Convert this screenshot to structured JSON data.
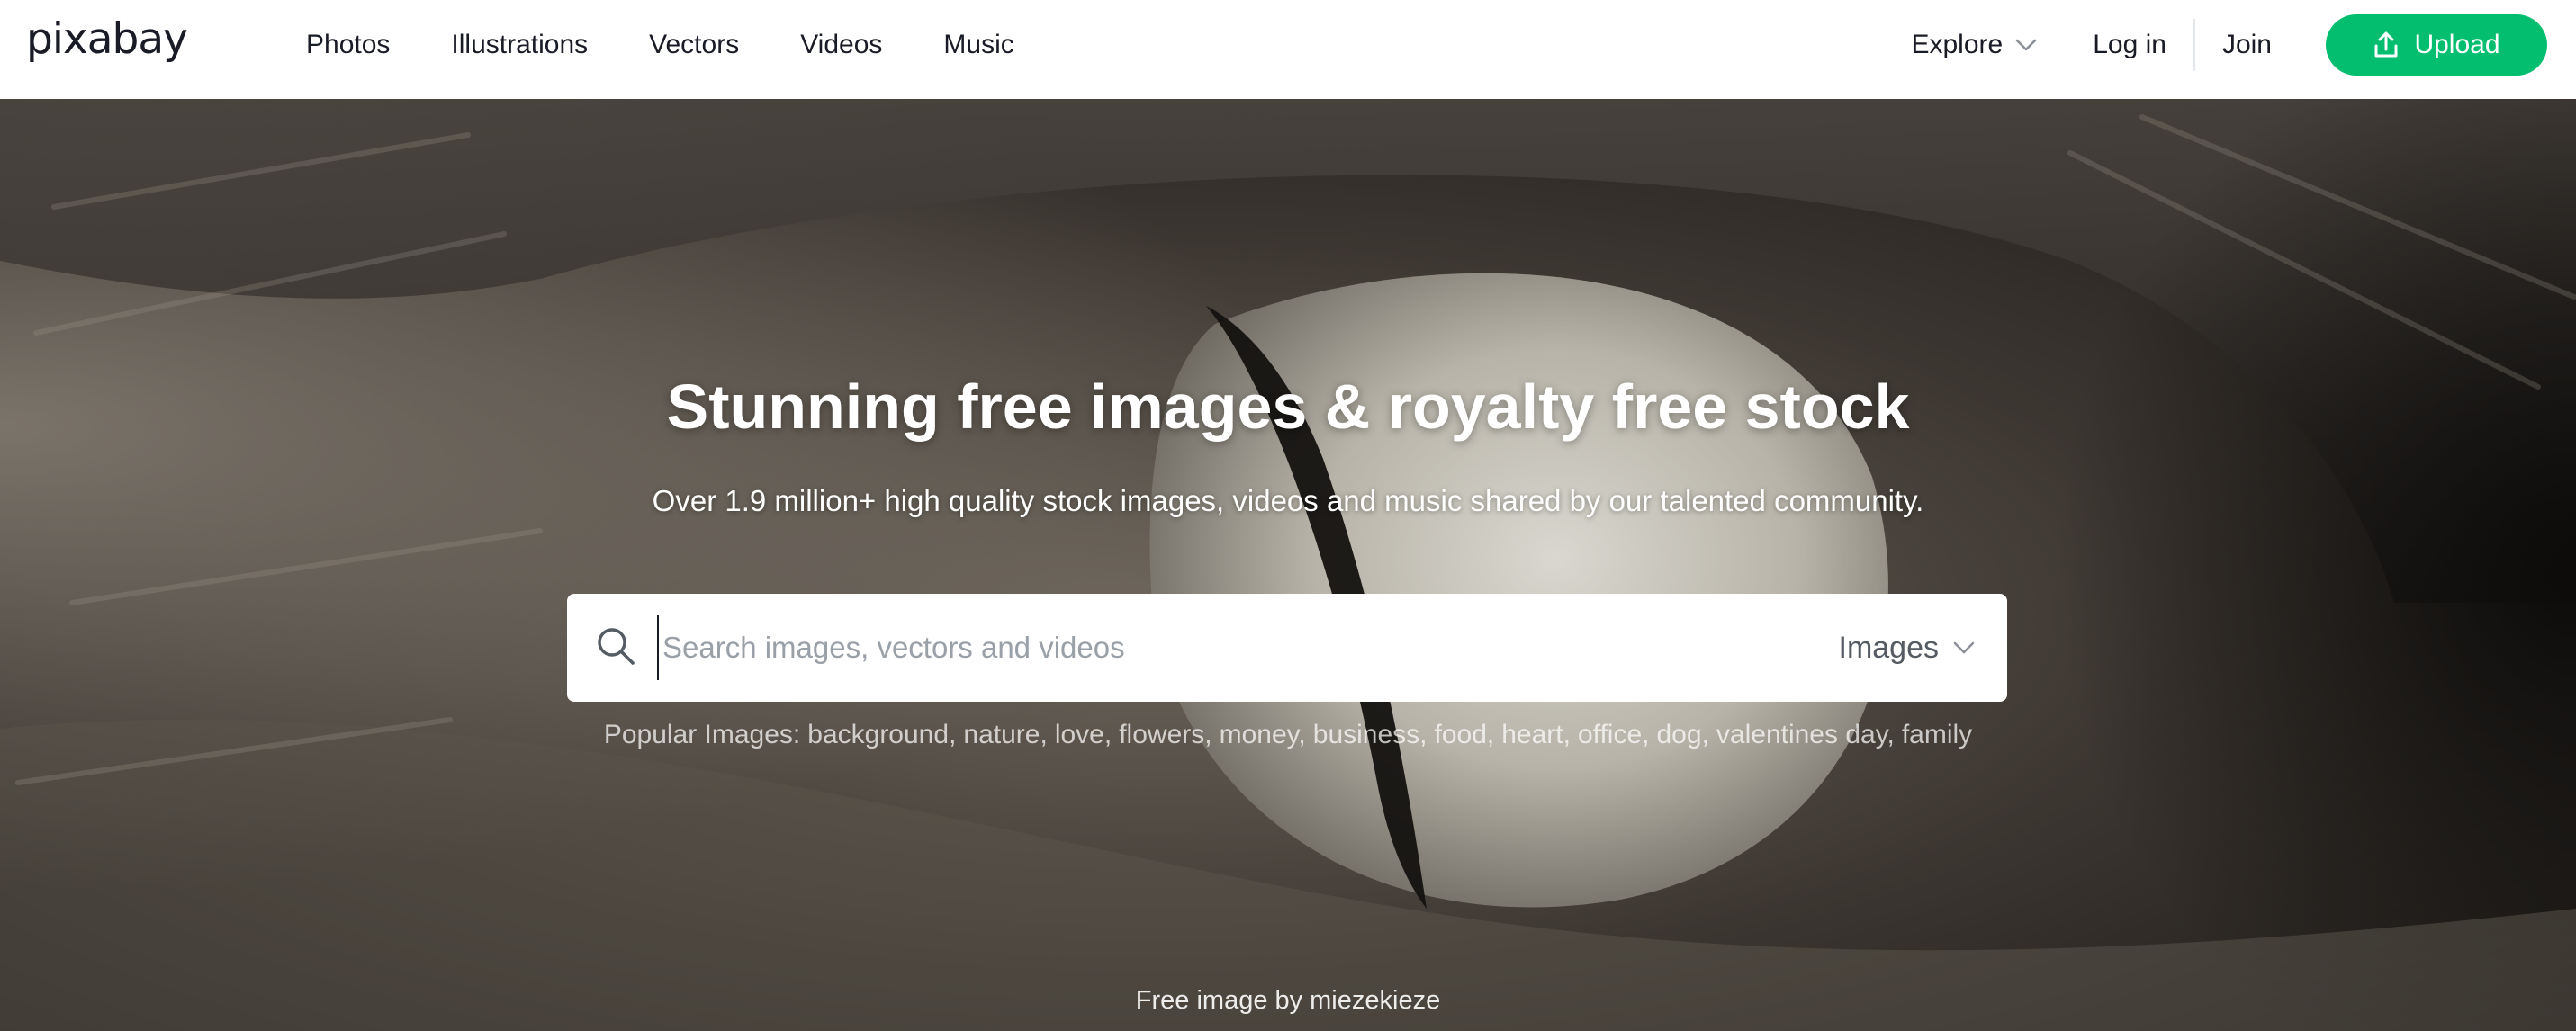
{
  "header": {
    "logo_text": "pixabay",
    "nav": [
      {
        "label": "Photos"
      },
      {
        "label": "Illustrations"
      },
      {
        "label": "Vectors"
      },
      {
        "label": "Videos"
      },
      {
        "label": "Music"
      }
    ],
    "explore_label": "Explore",
    "login_label": "Log in",
    "join_label": "Join",
    "upload_label": "Upload"
  },
  "hero": {
    "title": "Stunning free images & royalty free stock",
    "subtitle": "Over 1.9 million+ high quality stock images, videos and music shared by our talented community.",
    "search": {
      "placeholder": "Search images, vectors and videos",
      "value": "",
      "type_selected": "Images"
    },
    "popular": {
      "label": "Popular Images:",
      "tags": [
        "background",
        "nature",
        "love",
        "flowers",
        "money",
        "business",
        "food",
        "heart",
        "office",
        "dog",
        "valentines day",
        "family"
      ]
    },
    "credit": {
      "prefix": "Free image by",
      "author": "miezekieze"
    }
  },
  "colors": {
    "accent": "#02be6e",
    "header_bg": "#ffffff",
    "text_dark": "#191b26"
  },
  "icons": {
    "search": "search-icon",
    "upload": "upload-icon",
    "chevron": "chevron-down-icon"
  }
}
